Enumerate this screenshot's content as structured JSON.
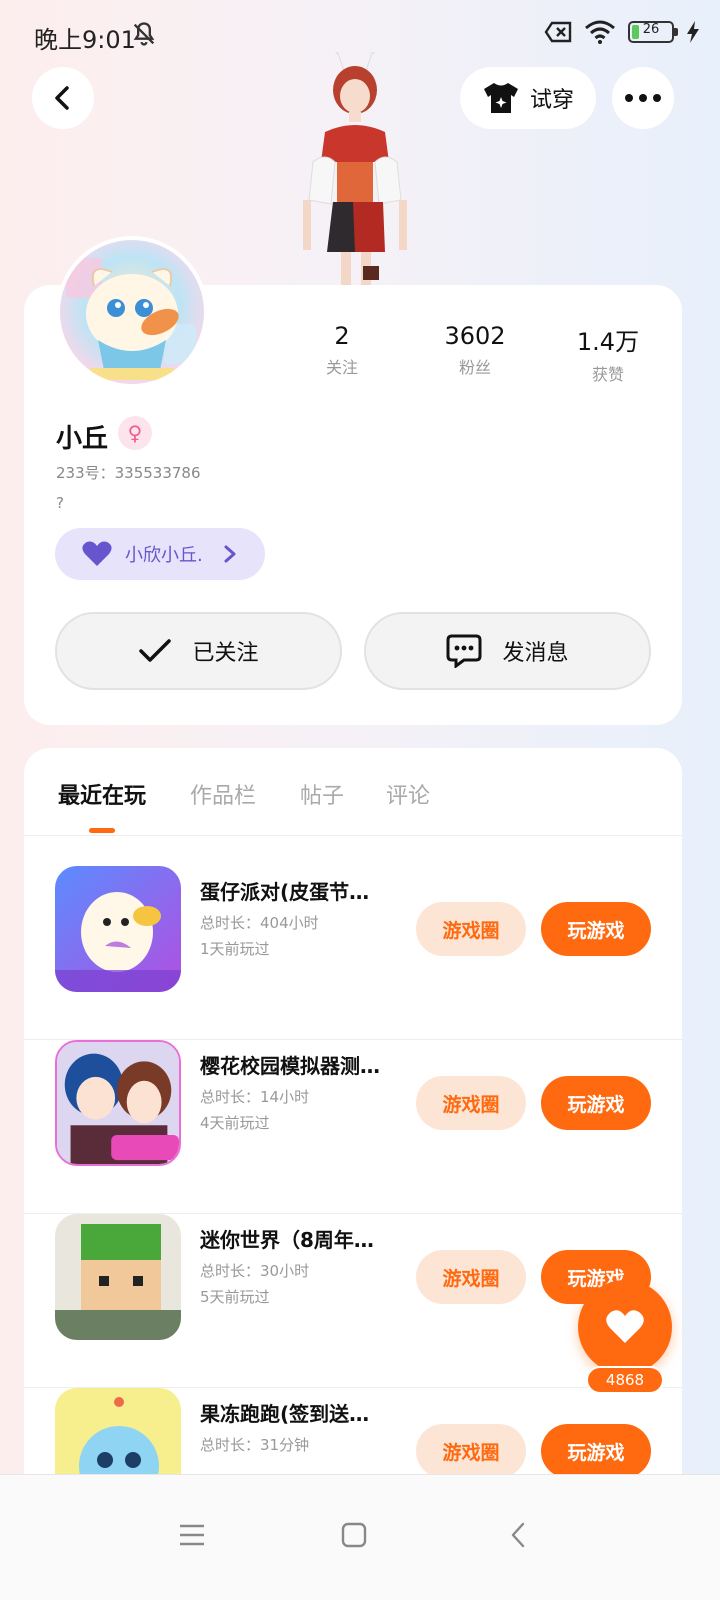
{
  "status_bar": {
    "time": "晚上9:01",
    "battery_level": 26,
    "battery_text": "26"
  },
  "header": {
    "back_icon": "chevron-left-icon",
    "tryon_label": "试穿",
    "more_icon": "more-dots-icon"
  },
  "profile": {
    "username": "小丘",
    "gender_symbol": "♀",
    "user_id": "233号：335533786",
    "bio": "?",
    "family_label": "小欣小丘.",
    "stats": [
      {
        "value": "2",
        "label": "关注"
      },
      {
        "value": "3602",
        "label": "粉丝"
      },
      {
        "value": "1.4万",
        "label": "获赞"
      }
    ],
    "follow_label": "已关注",
    "message_label": "发消息"
  },
  "tabs": [
    {
      "label": "最近在玩",
      "active": true
    },
    {
      "label": "作品栏",
      "active": false
    },
    {
      "label": "帖子",
      "active": false
    },
    {
      "label": "评论",
      "active": false
    }
  ],
  "games": [
    {
      "title": "蛋仔派对(皮蛋节…",
      "duration": "总时长：404小时",
      "last_played": "1天前玩过",
      "circle_label": "游戏圈",
      "play_label": "玩游戏"
    },
    {
      "title": "樱花校园模拟器测…",
      "duration": "总时长：14小时",
      "last_played": "4天前玩过",
      "circle_label": "游戏圈",
      "play_label": "玩游戏"
    },
    {
      "title": "迷你世界（8周年…",
      "duration": "总时长：30小时",
      "last_played": "5天前玩过",
      "circle_label": "游戏圈",
      "play_label": "玩游戏"
    },
    {
      "title": "果冻跑跑(签到送…",
      "duration": "总时长：31分钟",
      "last_played": "",
      "circle_label": "游戏圈",
      "play_label": "玩游戏"
    }
  ],
  "like_count": "4868",
  "colors": {
    "accent": "#ff6a10",
    "accent_light": "#fde5d6",
    "family_chip": "#e6e3fb",
    "gender_pink": "#ef5f8c"
  }
}
